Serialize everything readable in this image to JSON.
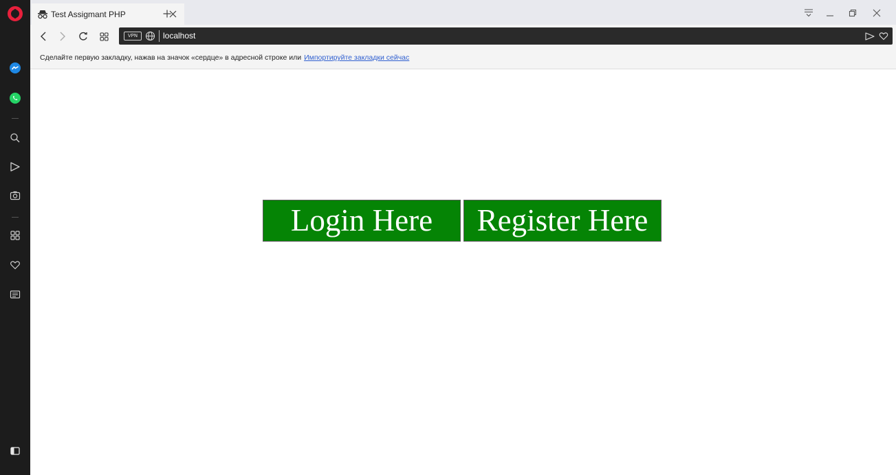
{
  "browser": {
    "tab": {
      "title": "Test Assigmant PHP",
      "icon": "incognito-icon"
    },
    "new_tab_label": "+",
    "address": {
      "vpn_label": "VPN",
      "url": "localhost"
    },
    "bookmarks_bar": {
      "message": "Сделайте первую закладку, нажав на значок «сердце» в адресной строке или",
      "import_link": "Импортируйте закладки сейчас"
    },
    "sidebar": {
      "items": [
        "opera-logo",
        "messenger-icon",
        "whatsapp-icon",
        "search-icon",
        "send-icon",
        "camera-icon",
        "speed-dial-icon",
        "heart-icon",
        "news-icon",
        "sidebar-toggle-icon"
      ]
    }
  },
  "page": {
    "login_label": "Login Here",
    "register_label": "Register Here"
  },
  "colors": {
    "button_bg": "#058405",
    "sidebar_bg": "#1c1c1c",
    "opera_red": "#e8203c",
    "messenger_blue": "#1e88e5",
    "whatsapp_green": "#25d366"
  }
}
